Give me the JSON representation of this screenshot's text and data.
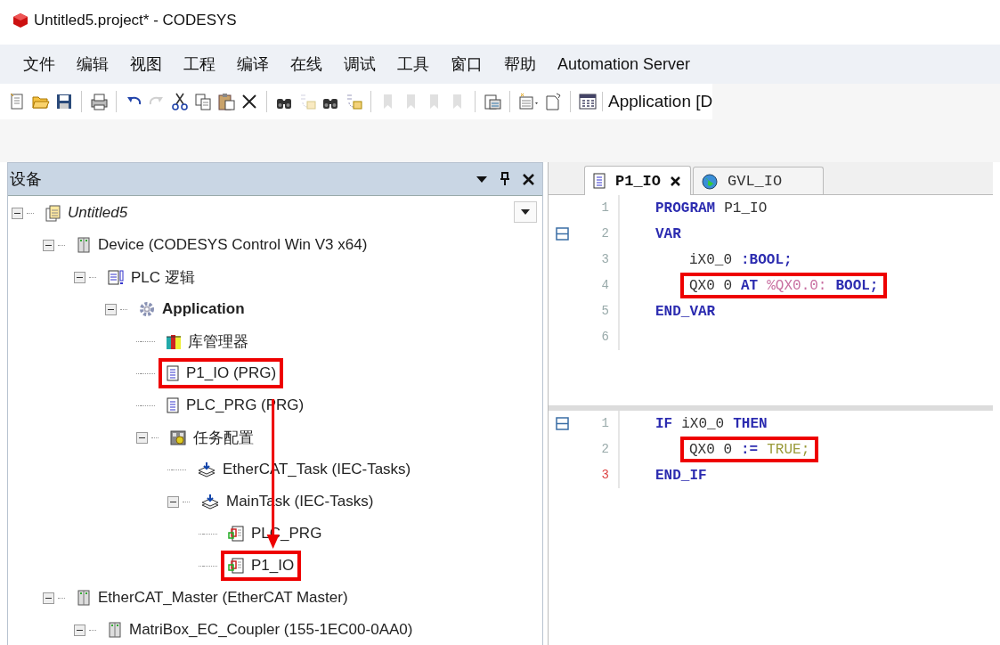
{
  "window": {
    "title": "Untitled5.project* - CODESYS"
  },
  "menu": [
    "文件",
    "编辑",
    "视图",
    "工程",
    "编译",
    "在线",
    "调试",
    "工具",
    "窗口",
    "帮助",
    "Automation Server"
  ],
  "toolbar": {
    "buttons": [
      {
        "kind": "new",
        "disabled": false
      },
      {
        "kind": "open",
        "disabled": false
      },
      {
        "kind": "save",
        "disabled": false
      },
      {
        "kind": "separator"
      },
      {
        "kind": "print",
        "disabled": false
      },
      {
        "kind": "separator"
      },
      {
        "kind": "undo",
        "disabled": false
      },
      {
        "kind": "redo",
        "disabled": true
      },
      {
        "kind": "cut",
        "disabled": false
      },
      {
        "kind": "copy",
        "disabled": false
      },
      {
        "kind": "paste",
        "disabled": false
      },
      {
        "kind": "delete",
        "disabled": false
      },
      {
        "kind": "separator"
      },
      {
        "kind": "find",
        "disabled": false
      },
      {
        "kind": "replace",
        "disabled": true
      },
      {
        "kind": "find",
        "disabled": false
      },
      {
        "kind": "replace",
        "disabled": false
      },
      {
        "kind": "separator"
      },
      {
        "kind": "bookmark",
        "disabled": true
      },
      {
        "kind": "bookmark",
        "disabled": true
      },
      {
        "kind": "bookmark",
        "disabled": true
      },
      {
        "kind": "bookmark",
        "disabled": true
      },
      {
        "kind": "separator"
      },
      {
        "kind": "clipboard",
        "disabled": false
      },
      {
        "kind": "separator"
      },
      {
        "kind": "object",
        "disabled": false
      },
      {
        "kind": "page",
        "disabled": false
      },
      {
        "kind": "separator"
      },
      {
        "kind": "grid",
        "disabled": false
      }
    ],
    "application_label": "Application [D"
  },
  "devices_panel": {
    "title": "设备",
    "tree": [
      {
        "label": "Untitled5",
        "kind": "project",
        "expanded": true,
        "highlighted": false,
        "children": [
          {
            "label": "Device (CODESYS Control Win V3 x64)",
            "kind": "device",
            "expanded": true,
            "highlighted": false,
            "children": [
              {
                "label": "PLC 逻辑",
                "kind": "plc-logic",
                "expanded": true,
                "highlighted": false,
                "children": [
                  {
                    "label": "Application",
                    "kind": "application",
                    "expanded": true,
                    "highlighted": false,
                    "children": [
                      {
                        "label": "库管理器",
                        "kind": "library",
                        "highlighted": false
                      },
                      {
                        "label": "P1_IO (PRG)",
                        "kind": "pou",
                        "highlighted": true
                      },
                      {
                        "label": "PLC_PRG (PRG)",
                        "kind": "pou",
                        "highlighted": false
                      },
                      {
                        "label": "任务配置",
                        "kind": "task-config",
                        "expanded": true,
                        "highlighted": false,
                        "children": [
                          {
                            "label": "EtherCAT_Task (IEC-Tasks)",
                            "kind": "task",
                            "highlighted": false
                          },
                          {
                            "label": "MainTask (IEC-Tasks)",
                            "kind": "task",
                            "expanded": true,
                            "highlighted": false,
                            "children": [
                              {
                                "label": "PLC_PRG",
                                "kind": "pou-call",
                                "highlighted": false
                              },
                              {
                                "label": "P1_IO",
                                "kind": "pou-call",
                                "highlighted": true
                              }
                            ]
                          }
                        ]
                      }
                    ]
                  }
                ]
              }
            ]
          },
          {
            "label": "EtherCAT_Master (EtherCAT Master)",
            "kind": "device",
            "expanded": true,
            "highlighted": false,
            "children": [
              {
                "label": "MatriBox_EC_Coupler (155-1EC00-0AA0)",
                "kind": "device",
                "expanded": true,
                "highlighted": false
              }
            ]
          }
        ]
      }
    ],
    "arrow": true
  },
  "editor": {
    "tabs": [
      {
        "label": "P1_IO",
        "kind": "pou",
        "selected": true,
        "closable": true
      },
      {
        "label": "GVL_IO",
        "kind": "globe",
        "selected": false,
        "closable": false
      }
    ],
    "declaration": [
      {
        "number": "1",
        "kind": "header",
        "fold": false,
        "flagged": false,
        "highlighted": false,
        "tokens": [
          {
            "kind": "keyword",
            "text": "PROGRAM"
          },
          {
            "kind": "name",
            "text": "P1_IO"
          }
        ]
      },
      {
        "number": "2",
        "kind": "header",
        "fold": true,
        "flagged": false,
        "highlighted": false,
        "tokens": [
          {
            "kind": "keyword",
            "text": "VAR"
          }
        ]
      },
      {
        "number": "3",
        "kind": "body",
        "fold": false,
        "flagged": false,
        "highlighted": false,
        "tokens": [
          {
            "kind": "name",
            "text": "iX0_0"
          },
          {
            "kind": "keyword",
            "text": " :BOOL;"
          }
        ]
      },
      {
        "number": "4",
        "kind": "body",
        "fold": false,
        "flagged": false,
        "highlighted": true,
        "tokens": [
          {
            "kind": "name",
            "text": "QX0 0"
          },
          {
            "kind": "keyword",
            "text": "AT"
          },
          {
            "kind": "address",
            "text": "%QX0.0:"
          },
          {
            "kind": "keyword",
            "text": "BOOL;"
          }
        ]
      },
      {
        "number": "5",
        "kind": "header",
        "fold": false,
        "flagged": false,
        "highlighted": false,
        "tokens": [
          {
            "kind": "keyword",
            "text": "END_VAR"
          }
        ]
      },
      {
        "number": "6",
        "kind": "header",
        "fold": false,
        "flagged": false
      }
    ],
    "implementation": [
      {
        "number": "1",
        "kind": "header",
        "fold": true,
        "flagged": false,
        "highlighted": false,
        "tokens": [
          {
            "kind": "keyword",
            "text": "IF"
          },
          {
            "kind": "name",
            "text": "iX0_0"
          },
          {
            "kind": "keyword",
            "text": "THEN"
          }
        ]
      },
      {
        "number": "2",
        "kind": "body",
        "fold": false,
        "flagged": false,
        "highlighted": true,
        "tokens": [
          {
            "kind": "name",
            "text": "QX0 0"
          },
          {
            "kind": "keyword",
            "text": ":="
          },
          {
            "kind": "literal",
            "text": "TRUE;"
          }
        ]
      },
      {
        "number": "3",
        "kind": "header",
        "fold": false,
        "flagged": true,
        "highlighted": false,
        "tokens": [
          {
            "kind": "keyword",
            "text": "END_IF"
          }
        ]
      }
    ]
  }
}
